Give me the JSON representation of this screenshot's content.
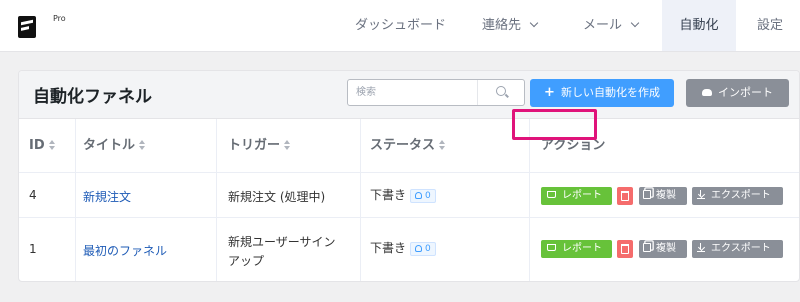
{
  "nav": {
    "logo_badge": "Pro",
    "items": [
      {
        "label": "ダッシュボード"
      },
      {
        "label": "連絡先"
      },
      {
        "label": "メール"
      },
      {
        "label": "自動化"
      },
      {
        "label": "設定"
      }
    ],
    "active": "自動化"
  },
  "page": {
    "title": "自動化ファネル",
    "search_placeholder": "検索",
    "create_button": "新しい自動化を作成",
    "import_button": "インポート"
  },
  "table": {
    "columns": [
      "ID",
      "タイトル",
      "トリガー",
      "ステータス",
      "アクション"
    ],
    "rows": [
      {
        "id": "4",
        "title": "新規注文",
        "trigger": "新規注文 (処理中)",
        "trigger_line2": "",
        "status": "下書き",
        "count": "0"
      },
      {
        "id": "1",
        "title": "最初のファネル",
        "trigger": "新規ユーザーサイン",
        "trigger_line2": "アップ",
        "status": "下書き",
        "count": "0"
      }
    ],
    "actions": {
      "report": "レポート",
      "duplicate": "複製",
      "export": "エクスポート"
    }
  },
  "colors": {
    "primary": "#409eff",
    "success": "#67c23a",
    "danger": "#f56c6c",
    "neutral": "#8a8f98",
    "highlight": "#e0137a"
  }
}
